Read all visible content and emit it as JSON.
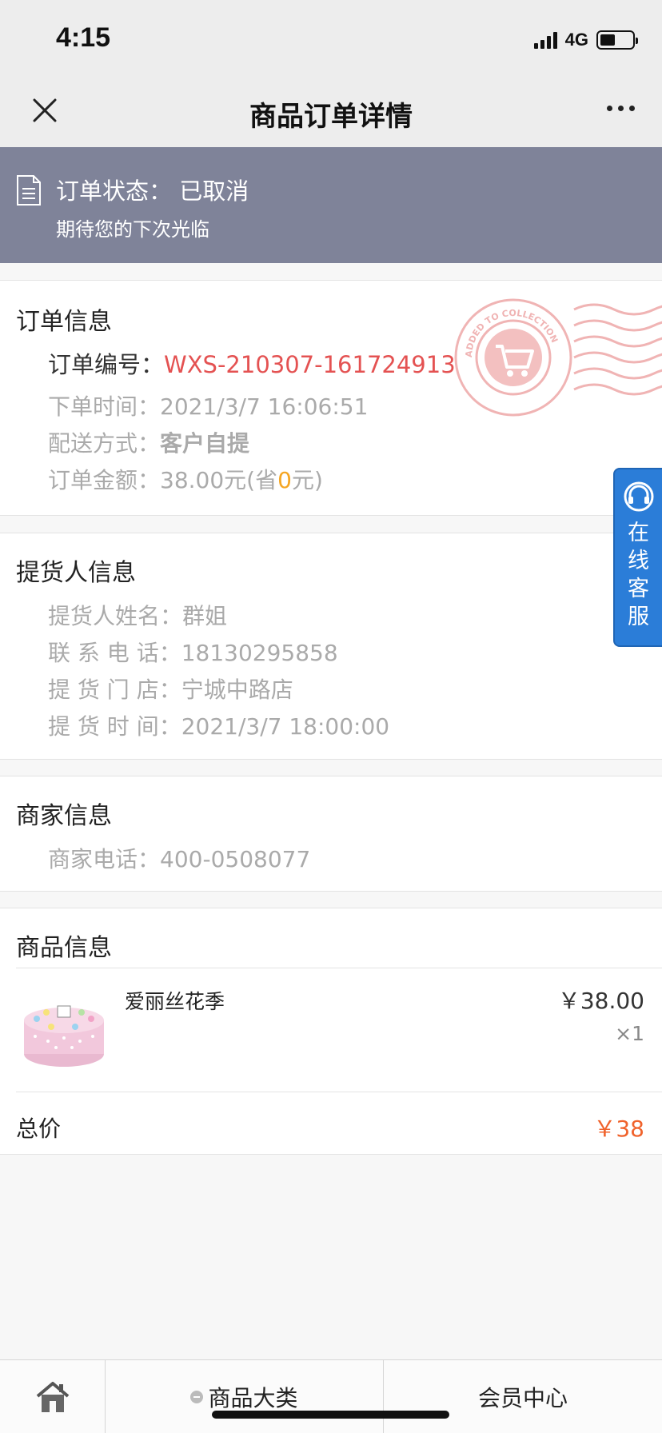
{
  "status_bar": {
    "time": "4:15",
    "network": "4G",
    "battery_level": 0.4
  },
  "nav": {
    "title": "商品订单详情"
  },
  "order_status": {
    "label": "订单状态：",
    "value": "已取消",
    "message": "期待您的下次光临"
  },
  "order_info": {
    "title": "订单信息",
    "number_label": "订单编号：",
    "number_value": "WXS-210307-161724913",
    "time_label": "下单时间：",
    "time_value": "2021/3/7 16:06:51",
    "delivery_label": "配送方式：",
    "delivery_value": "客户自提",
    "amount_label": "订单金额：",
    "amount_prefix": "38.00元(省",
    "amount_saved": "0",
    "amount_suffix": "元)",
    "stamp_text": "ADDED TO COLLECTION"
  },
  "pickup_info": {
    "title": "提货人信息",
    "name_label": "提货人姓名：",
    "name_value": "群姐",
    "phone_label": "联 系 电 话：",
    "phone_value": "18130295858",
    "store_label": "提 货 门 店：",
    "store_value": "宁城中路店",
    "time_label": "提 货 时 间：",
    "time_value": "2021/3/7 18:00:00"
  },
  "merchant_info": {
    "title": "商家信息",
    "phone_label": "商家电话：",
    "phone_value": "400-0508077"
  },
  "product_info": {
    "title": "商品信息",
    "items": [
      {
        "name": "爱丽丝花季",
        "price": "￥38.00",
        "qty": "×1"
      }
    ],
    "total_label": "总价",
    "total_value": "￥38"
  },
  "service_float": {
    "chars": [
      "在",
      "线",
      "客",
      "服"
    ]
  },
  "tab_bar": {
    "category_label": "商品大类",
    "member_label": "会员中心"
  },
  "colors": {
    "banner_bg": "#7f8399",
    "order_number": "#e45252",
    "saved_amount": "#f5a623",
    "total_price": "#f0622b",
    "service_bg": "#2b7dd8"
  }
}
